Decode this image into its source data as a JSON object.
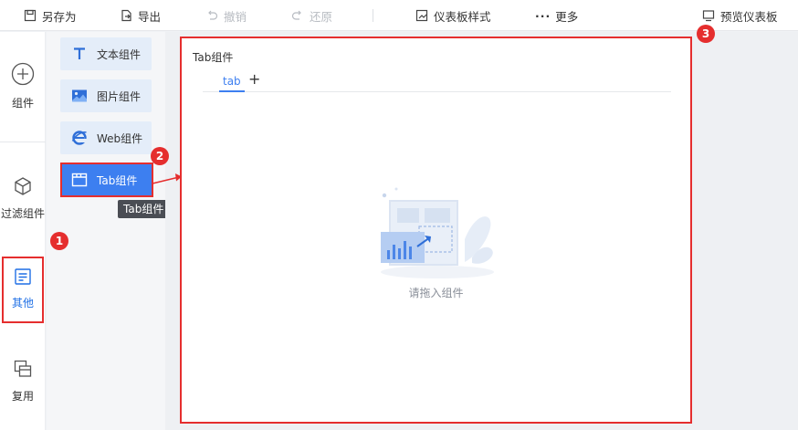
{
  "toolbar": {
    "save_as": "另存为",
    "export": "导出",
    "undo": "撤销",
    "redo": "还原",
    "dashboard_style": "仪表板样式",
    "more": "更多",
    "preview": "预览仪表板"
  },
  "leftnav": {
    "items": [
      {
        "label": "组件",
        "icon": "plus-circle-icon"
      },
      {
        "label": "过滤组件",
        "icon": "cube-icon"
      },
      {
        "label": "其他",
        "icon": "document-icon"
      },
      {
        "label": "复用",
        "icon": "copy-icon"
      }
    ]
  },
  "panel": {
    "components": [
      {
        "label": "文本组件",
        "icon": "text-icon"
      },
      {
        "label": "图片组件",
        "icon": "image-icon"
      },
      {
        "label": "Web组件",
        "icon": "web-icon"
      },
      {
        "label": "Tab组件",
        "icon": "tab-icon"
      }
    ],
    "tooltip": "Tab组件"
  },
  "widget": {
    "title": "Tab组件",
    "tab_label": "tab",
    "add_tab": "+",
    "empty_text": "请拖入组件"
  },
  "annotations": {
    "badges": [
      "1",
      "2",
      "3"
    ],
    "color": "#e52e2e"
  },
  "colors": {
    "accent": "#3d7ff0",
    "active_nav": "#1f6fe5"
  }
}
